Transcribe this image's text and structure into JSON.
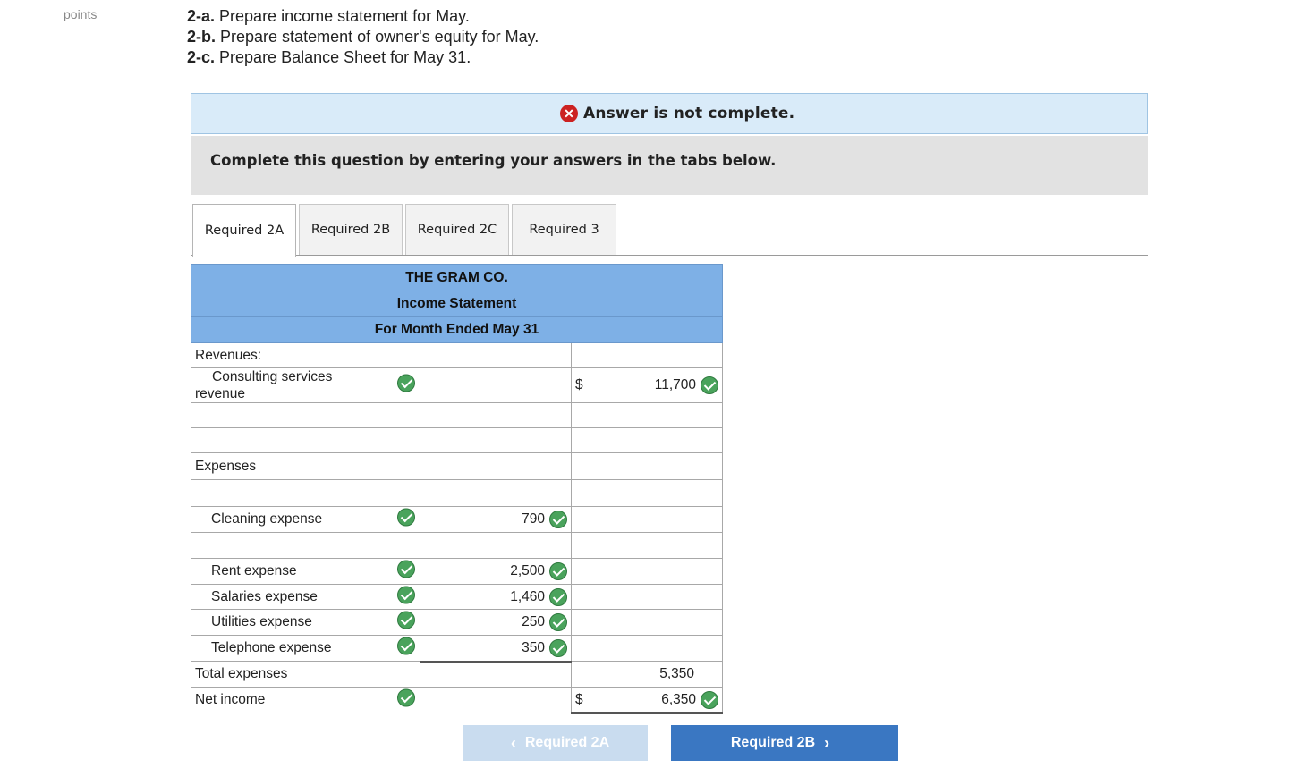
{
  "points_label": "points",
  "instructions": [
    {
      "prefix": "2-a.",
      "text": " Prepare income statement for May."
    },
    {
      "prefix": "2-b.",
      "text": " Prepare statement of owner's equity for May."
    },
    {
      "prefix": "2-c.",
      "text": " Prepare Balance Sheet for May 31."
    }
  ],
  "banner": {
    "text": "Answer is not complete.",
    "icon": "x-icon"
  },
  "complete_text": "Complete this question by entering your answers in the tabs below.",
  "tabs": [
    {
      "label": "Required 2A",
      "active": true
    },
    {
      "label": "Required 2B",
      "active": false
    },
    {
      "label": "Required 2C",
      "active": false
    },
    {
      "label": "Required 3",
      "active": false
    }
  ],
  "statement": {
    "company": "THE GRAM CO.",
    "title": "Income Statement",
    "period": "For Month Ended May 31",
    "revenues_label": "Revenues:",
    "consulting_label": "Consulting services revenue",
    "consulting_value": "11,700",
    "dollar_sign": "$",
    "expenses_label": "Expenses",
    "cleaning_label": "Cleaning expense",
    "cleaning_value": "790",
    "rent_label": "Rent expense",
    "rent_value": "2,500",
    "salaries_label": "Salaries expense",
    "salaries_value": "1,460",
    "utilities_label": "Utilities expense",
    "utilities_value": "250",
    "telephone_label": "Telephone expense",
    "telephone_value": "350",
    "total_expenses_label": "Total expenses",
    "total_expenses_value": "5,350",
    "net_income_label": "Net income",
    "net_income_value": "6,350"
  },
  "nav": {
    "prev_label": "Required 2A",
    "next_label": "Required 2B"
  },
  "colors": {
    "header_blue": "#7eb0e6",
    "check_green": "#4aa35c",
    "next_button": "#3a77c2",
    "banner_bg": "#d9ebf9"
  }
}
